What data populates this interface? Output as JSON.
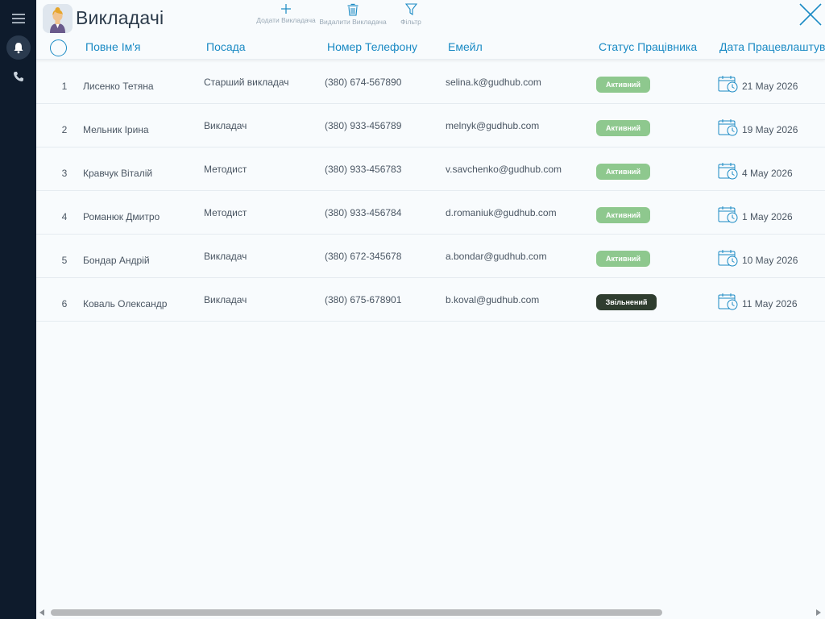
{
  "app": {
    "title": "Викладачі",
    "icon": "teacher-avatar-icon"
  },
  "sidebar": {
    "items": [
      {
        "icon": "menu-icon"
      },
      {
        "icon": "bell-icon",
        "active": true
      },
      {
        "icon": "phone-icon"
      }
    ]
  },
  "toolbar": {
    "add_label": "Додати Викладача",
    "delete_label": "Видалити Викладача",
    "filter_label": "Фільтр"
  },
  "table": {
    "columns": [
      "Повне Ім'я",
      "Посада",
      "Номер Телефону",
      "Емейл",
      "Статус Працівника",
      "Дата Працевлаштування"
    ],
    "rows": [
      {
        "num": "1",
        "name": "Лисенко Тетяна",
        "position": "Старший викладач",
        "phone": "(380) 674-567890",
        "email": "selina.k@gudhub.com",
        "status": "Активний",
        "status_type": "active",
        "date": "21 May 2026"
      },
      {
        "num": "2",
        "name": "Мельник Ірина",
        "position": "Викладач",
        "phone": "(380) 933-456789",
        "email": "melnyk@gudhub.com",
        "status": "Активний",
        "status_type": "active",
        "date": "19 May 2026"
      },
      {
        "num": "3",
        "name": "Кравчук Віталій",
        "position": "Методист",
        "phone": "(380) 933-456783",
        "email": "v.savchenko@gudhub.com",
        "status": "Активний",
        "status_type": "active",
        "date": "4 May 2026"
      },
      {
        "num": "4",
        "name": "Романюк Дмитро",
        "position": "Методист",
        "phone": "(380) 933-456784",
        "email": "d.romaniuk@gudhub.com",
        "status": "Активний",
        "status_type": "active",
        "date": "1 May 2026"
      },
      {
        "num": "5",
        "name": "Бондар Андрій",
        "position": "Викладач",
        "phone": "(380) 672-345678",
        "email": "a.bondar@gudhub.com",
        "status": "Активний",
        "status_type": "active",
        "date": "10 May 2026"
      },
      {
        "num": "6",
        "name": "Коваль Олександр",
        "position": "Викладач",
        "phone": "(380) 675-678901",
        "email": "b.koval@gudhub.com",
        "status": "Звільнений",
        "status_type": "fired",
        "date": "11 May 2026"
      }
    ]
  },
  "colors": {
    "accent": "#1a8ac4",
    "sidebar_bg": "#0e1b2c",
    "active_badge": "#8ec88e",
    "fired_badge": "#2f3d2f"
  }
}
